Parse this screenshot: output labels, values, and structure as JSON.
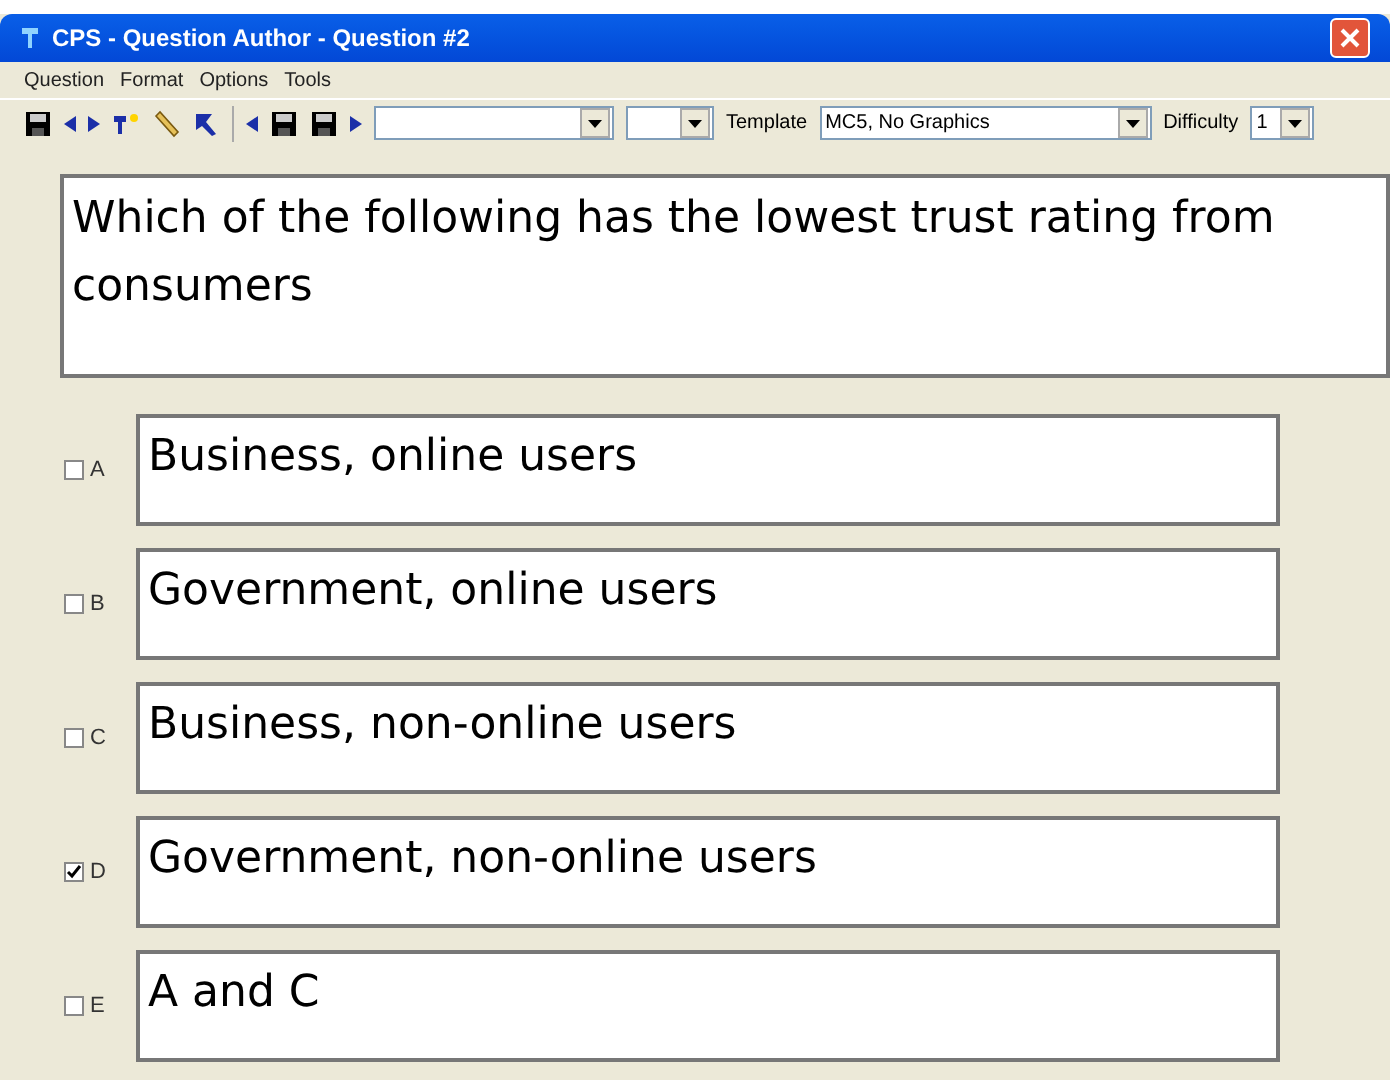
{
  "window": {
    "title": "CPS - Question Author - Question #2"
  },
  "menu": [
    "Question",
    "Format",
    "Options",
    "Tools"
  ],
  "toolbar": {
    "template_label": "Template",
    "template_value": "MC5, No Graphics",
    "difficulty_label": "Difficulty",
    "difficulty_value": "1"
  },
  "question": "Which of the following has the lowest trust rating from consumers",
  "answers": [
    {
      "letter": "A",
      "text": "Business, online users",
      "checked": false
    },
    {
      "letter": "B",
      "text": "Government, online users",
      "checked": false
    },
    {
      "letter": "C",
      "text": "Business, non-online users",
      "checked": false
    },
    {
      "letter": "D",
      "text": "Government, non-online users",
      "checked": true
    },
    {
      "letter": "E",
      "text": "A and C",
      "checked": false
    }
  ]
}
